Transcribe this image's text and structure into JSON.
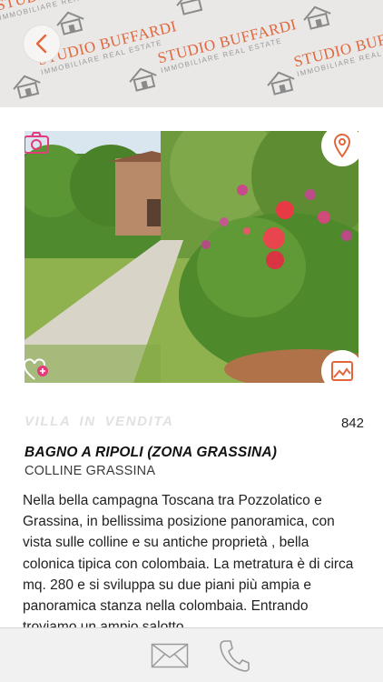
{
  "header": {
    "brand_name": "STUDIO BUFFARDI",
    "brand_tagline": "IMMOBILIARE REAL ESTATE",
    "back_icon": "chevron-left-icon",
    "colors": {
      "brand": "#e2663c",
      "background": "#e9e8e7"
    }
  },
  "photo": {
    "camera_icon": "camera-icon",
    "location_icon": "map-pin-icon",
    "favorite_icon": "heart-plus-icon",
    "gallery_icon": "image-gallery-icon",
    "accent": "#e23c7a"
  },
  "listing": {
    "type": "VILLA  IN  VENDITA",
    "reference": "842",
    "location": "BAGNO A RIPOLI (ZONA GRASSINA)",
    "zone": "COLLINE GRASSINA",
    "description": "Nella bella campagna Toscana tra Pozzolatico e Grassina, in bellissima posizione panoramica, con vista sulle colline e su antiche proprietà , bella colonica tipica con colombaia. La metratura è di circa mq. 280 e si sviluppa su due piani più ampia e panoramica stanza nella colombaia. Entrando troviamo un ampio salotto"
  },
  "footer": {
    "mail_icon": "envelope-icon",
    "phone_icon": "phone-icon"
  }
}
